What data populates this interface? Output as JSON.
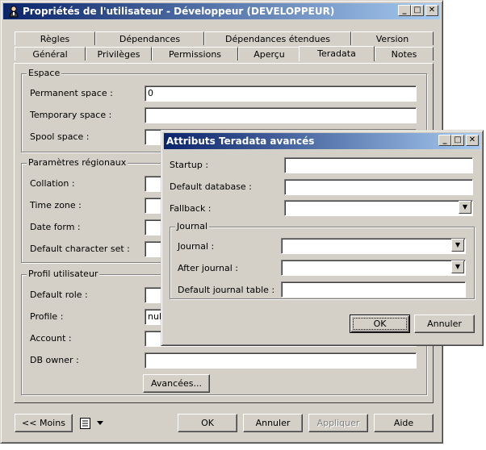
{
  "main_window": {
    "title": "Propriétés de l'utilisateur - Développeur (DEVELOPPEUR)",
    "tabs_row1": [
      "Règles",
      "Dépendances",
      "Dépendances étendues",
      "Version"
    ],
    "tabs_row2": [
      "Général",
      "Privilèges",
      "Permissions",
      "Aperçu",
      "Teradata",
      "Notes"
    ],
    "active_tab": "Teradata",
    "espace": {
      "legend": "Espace",
      "permanent_label": "Permanent space :",
      "permanent_value": "0",
      "temporary_label": "Temporary space :",
      "temporary_value": "",
      "spool_label": "Spool space :",
      "spool_value": ""
    },
    "regional": {
      "legend": "Paramètres régionaux",
      "collation_label": "Collation :",
      "timezone_label": "Time zone :",
      "dateform_label": "Date form :",
      "charset_label": "Default character set :"
    },
    "profile": {
      "legend": "Profil utilisateur",
      "role_label": "Default role :",
      "profile_label": "Profile :",
      "profile_value": "null",
      "account_label": "Account :",
      "dbowner_label": "DB owner :",
      "dbowner_value": ""
    },
    "advanced_button": "Avancées...",
    "footer": {
      "less_button": "<< Moins",
      "ok_button": "OK",
      "cancel_button": "Annuler",
      "apply_button": "Appliquer",
      "help_button": "Aide"
    }
  },
  "dialog": {
    "title": "Attributs Teradata avancés",
    "startup_label": "Startup :",
    "startup_value": "",
    "default_db_label": "Default database :",
    "default_db_value": "",
    "fallback_label": "Fallback :",
    "fallback_value": "",
    "journal_group": {
      "legend": "Journal",
      "journal_label": "Journal :",
      "journal_value": "",
      "after_label": "After journal :",
      "after_value": "",
      "table_label": "Default journal table :",
      "table_value": ""
    },
    "ok_button": "OK",
    "cancel_button": "Annuler"
  }
}
